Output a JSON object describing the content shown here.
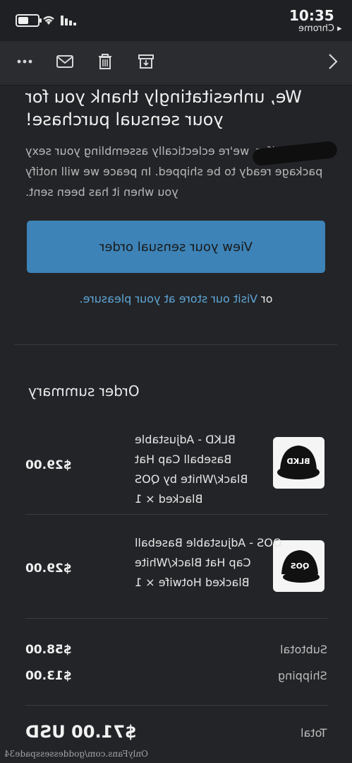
{
  "status": {
    "time": "10:35",
    "back_app": "◂ Chrome"
  },
  "toolbar": {
    "icons": [
      "more-icon",
      "mail-icon",
      "trash-icon",
      "archive-icon",
      "chevron-right-icon"
    ]
  },
  "email": {
    "thanks": "We, unhesitatingly thank you for your sensual purchase!",
    "lead": "Hi Jennifer, we're eclectically assembling your sexy package ready to be shipped. In peace we will notify you when it has been sent.",
    "button_label": "View your sensual order",
    "or_text": "or",
    "store_link": "Visit our store at your pleasure."
  },
  "summary": {
    "title": "Order summary",
    "items": [
      {
        "name": "BLKD - Adjustable Baseball Cap Hat Black/White by QOS Blacked × 1",
        "price": "$29.00",
        "cap_text": "BLKD"
      },
      {
        "name": "QOS - Adjustable Baseball Cap Hat Black/White Blacked Hotwife × 1",
        "price": "$29.00",
        "cap_text": "QOS"
      }
    ],
    "subtotal_label": "Subtotal",
    "subtotal_value": "$58.00",
    "shipping_label": "Shipping",
    "shipping_value": "$13.00",
    "total_label": "Total",
    "total_value": "$71.00 USD"
  },
  "watermark": "OnlyFans.com/goddessesspade34",
  "colors": {
    "accent": "#3d83b7",
    "link": "#5fa6d6",
    "background": "#232427"
  }
}
